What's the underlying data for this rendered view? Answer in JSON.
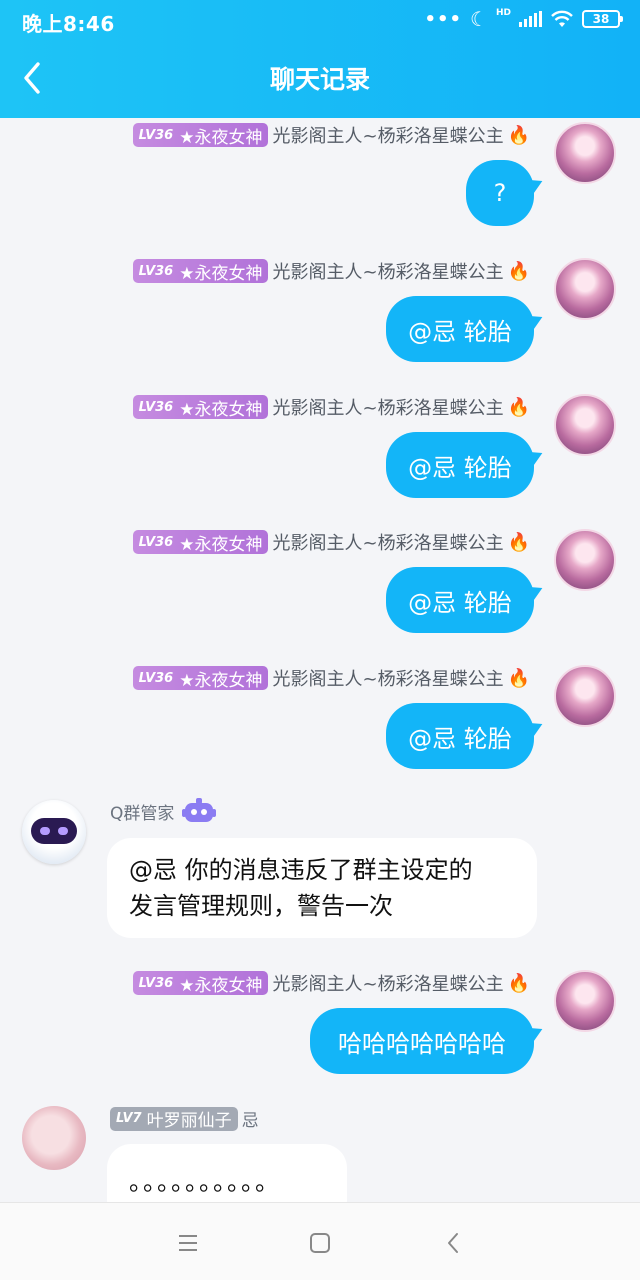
{
  "status_bar": {
    "time": "晚上8:46",
    "network": "HD",
    "battery": "38"
  },
  "header": {
    "title": "聊天记录"
  },
  "outgoing_sender": {
    "level": "LV36",
    "title": "★永夜女神",
    "name": "光影阁主人~杨彩洛星蝶公主",
    "flame": "🔥"
  },
  "messages": [
    {
      "text": "?"
    },
    {
      "text": "@忌 轮胎"
    },
    {
      "text": "@忌 轮胎"
    },
    {
      "text": "@忌 轮胎"
    },
    {
      "text": "@忌 轮胎"
    }
  ],
  "bot_message": {
    "name": "Q群管家",
    "line1": "@忌 你的消息违反了群主设定的",
    "line2": "发言管理规则，警告一次"
  },
  "laugh_message": {
    "text": "哈哈哈哈哈哈哈"
  },
  "last_message": {
    "level": "LV7",
    "title": "叶罗丽仙子",
    "name": "忌",
    "text": "。。。。。。。。。。"
  }
}
